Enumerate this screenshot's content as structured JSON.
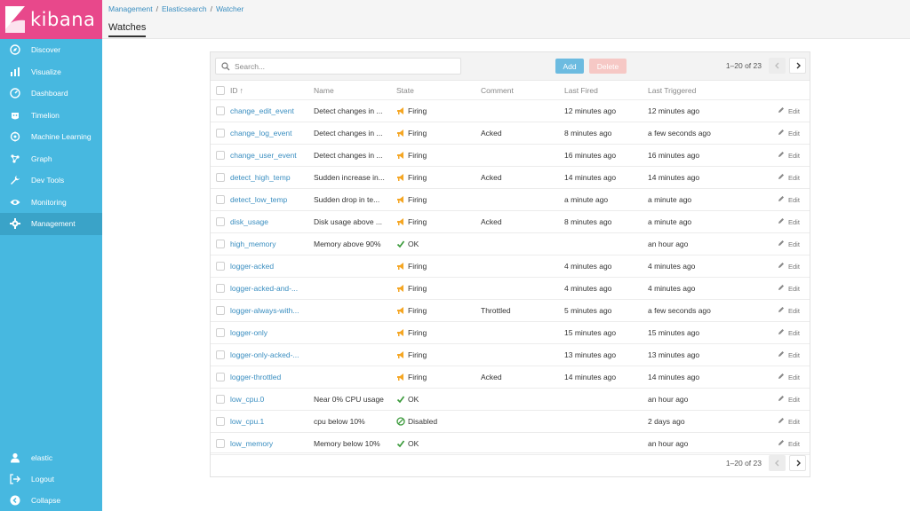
{
  "app": {
    "name": "kibana"
  },
  "colors": {
    "sidebar": "#47b8e0",
    "logo_bg": "#e8488b",
    "link": "#3a8ec0",
    "firing": "#f5a623",
    "ok": "#3b9a3b"
  },
  "sidebar": {
    "items": [
      {
        "label": "Discover",
        "icon": "compass-icon"
      },
      {
        "label": "Visualize",
        "icon": "bar-chart-icon"
      },
      {
        "label": "Dashboard",
        "icon": "dashboard-icon"
      },
      {
        "label": "Timelion",
        "icon": "timelion-icon"
      },
      {
        "label": "Machine Learning",
        "icon": "machine-learning-icon"
      },
      {
        "label": "Graph",
        "icon": "graph-icon"
      },
      {
        "label": "Dev Tools",
        "icon": "wrench-icon"
      },
      {
        "label": "Monitoring",
        "icon": "eye-icon"
      },
      {
        "label": "Management",
        "icon": "gear-icon",
        "active": true
      }
    ],
    "bottom": [
      {
        "label": "elastic",
        "icon": "user-icon"
      },
      {
        "label": "Logout",
        "icon": "logout-icon"
      },
      {
        "label": "Collapse",
        "icon": "collapse-icon"
      }
    ]
  },
  "header": {
    "breadcrumb": [
      "Management",
      "Elasticsearch",
      "Watcher"
    ],
    "separator": "/",
    "title": "Watches"
  },
  "toolbar": {
    "search_placeholder": "Search...",
    "add_label": "Add",
    "delete_label": "Delete",
    "pagination": "1–20 of 23"
  },
  "table": {
    "columns": [
      "ID",
      "Name",
      "State",
      "Comment",
      "Last Fired",
      "Last Triggered"
    ],
    "sort_indicator": "↑",
    "edit_label": "Edit",
    "rows": [
      {
        "id": "change_edit_event",
        "name": "Detect changes in ...",
        "state": "Firing",
        "comment": "",
        "last_fired": "12 minutes ago",
        "last_triggered": "12 minutes ago"
      },
      {
        "id": "change_log_event",
        "name": "Detect changes in ...",
        "state": "Firing",
        "comment": "Acked",
        "last_fired": "8 minutes ago",
        "last_triggered": "a few seconds ago"
      },
      {
        "id": "change_user_event",
        "name": "Detect changes in ...",
        "state": "Firing",
        "comment": "",
        "last_fired": "16 minutes ago",
        "last_triggered": "16 minutes ago"
      },
      {
        "id": "detect_high_temp",
        "name": "Sudden increase in...",
        "state": "Firing",
        "comment": "Acked",
        "last_fired": "14 minutes ago",
        "last_triggered": "14 minutes ago"
      },
      {
        "id": "detect_low_temp",
        "name": "Sudden drop in te...",
        "state": "Firing",
        "comment": "",
        "last_fired": "a minute ago",
        "last_triggered": "a minute ago"
      },
      {
        "id": "disk_usage",
        "name": "Disk usage above ...",
        "state": "Firing",
        "comment": "Acked",
        "last_fired": "8 minutes ago",
        "last_triggered": "a minute ago"
      },
      {
        "id": "high_memory",
        "name": "Memory above 90%",
        "state": "OK",
        "comment": "",
        "last_fired": "",
        "last_triggered": "an hour ago"
      },
      {
        "id": "logger-acked",
        "name": "",
        "state": "Firing",
        "comment": "",
        "last_fired": "4 minutes ago",
        "last_triggered": "4 minutes ago"
      },
      {
        "id": "logger-acked-and-...",
        "name": "",
        "state": "Firing",
        "comment": "",
        "last_fired": "4 minutes ago",
        "last_triggered": "4 minutes ago"
      },
      {
        "id": "logger-always-with...",
        "name": "",
        "state": "Firing",
        "comment": "Throttled",
        "last_fired": "5 minutes ago",
        "last_triggered": "a few seconds ago"
      },
      {
        "id": "logger-only",
        "name": "",
        "state": "Firing",
        "comment": "",
        "last_fired": "15 minutes ago",
        "last_triggered": "15 minutes ago"
      },
      {
        "id": "logger-only-acked-...",
        "name": "",
        "state": "Firing",
        "comment": "",
        "last_fired": "13 minutes ago",
        "last_triggered": "13 minutes ago"
      },
      {
        "id": "logger-throttled",
        "name": "",
        "state": "Firing",
        "comment": "Acked",
        "last_fired": "14 minutes ago",
        "last_triggered": "14 minutes ago"
      },
      {
        "id": "low_cpu.0",
        "name": "Near 0% CPU usage",
        "state": "OK",
        "comment": "",
        "last_fired": "",
        "last_triggered": "an hour ago"
      },
      {
        "id": "low_cpu.1",
        "name": "cpu below 10%",
        "state": "Disabled",
        "comment": "",
        "last_fired": "",
        "last_triggered": "2 days ago"
      },
      {
        "id": "low_memory",
        "name": "Memory below 10%",
        "state": "OK",
        "comment": "",
        "last_fired": "",
        "last_triggered": "an hour ago"
      }
    ]
  },
  "footer": {
    "pagination": "1–20 of 23"
  }
}
